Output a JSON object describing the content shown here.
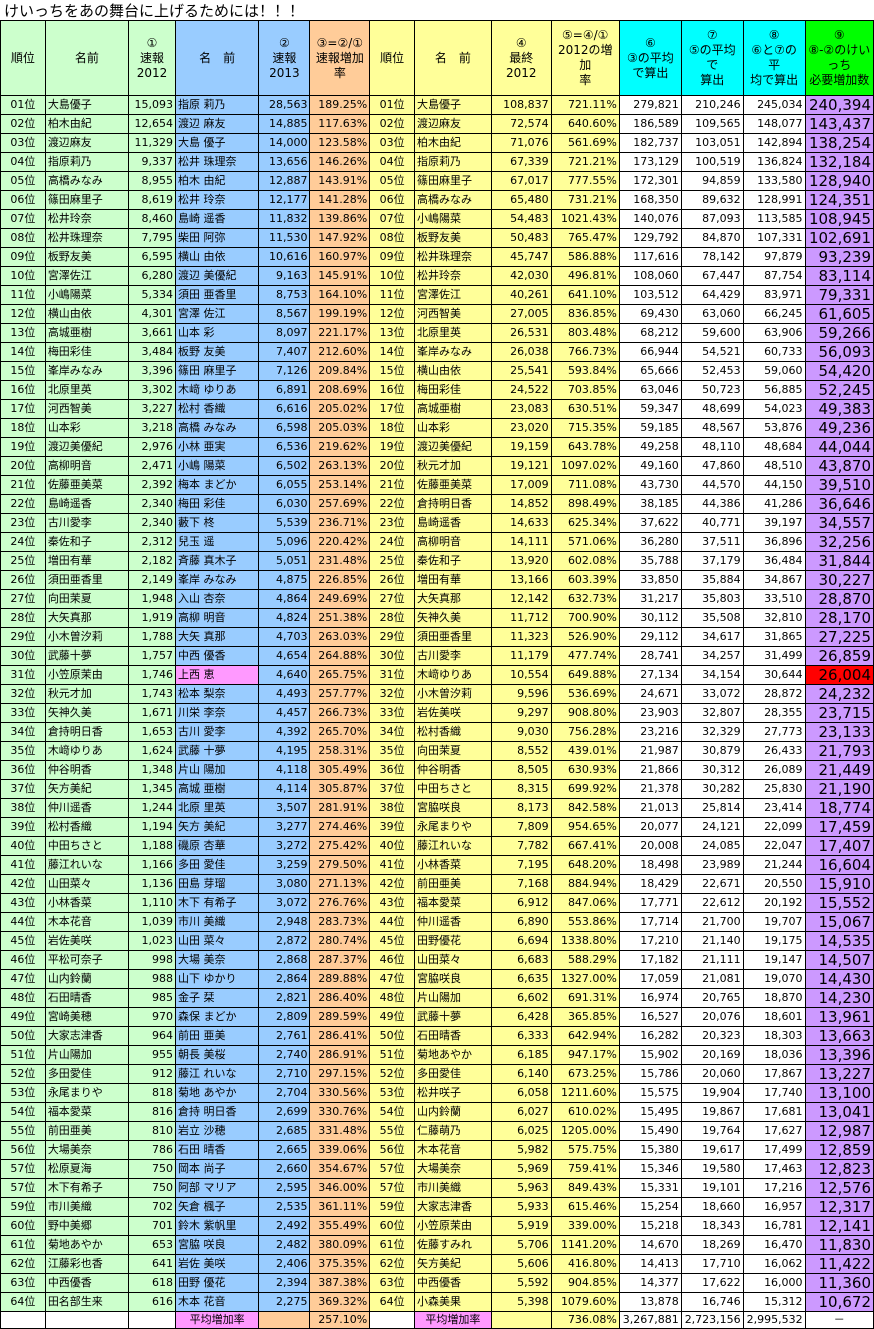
{
  "title": "けいっちをあの舞台に上げるためには！！！",
  "headers": [
    "順位",
    "名前",
    "①\n速報\n2012",
    "名　前",
    "②\n速報\n2013",
    "③=②/①\n速報増加\n率",
    "順位",
    "名　前",
    "④\n最終\n2012",
    "⑤=④/①\n2012の増加\n率",
    "⑥\n③の平均\nで算出",
    "⑦\n⑤の平均で\n算出",
    "⑧\n⑥と⑦の平\n均で算出",
    "⑨\n⑧-②のけいっち\n必要増加数"
  ],
  "rows": [
    [
      "01位",
      "大島優子",
      "15,093",
      "指原 莉乃",
      "28,563",
      "189.25%",
      "01位",
      "大島優子",
      "108,837",
      "721.11%",
      "279,821",
      "210,246",
      "245,034",
      "240,394"
    ],
    [
      "02位",
      "柏木由紀",
      "12,654",
      "渡辺 麻友",
      "14,885",
      "117.63%",
      "02位",
      "渡辺麻友",
      "72,574",
      "640.60%",
      "186,589",
      "109,565",
      "148,077",
      "143,437"
    ],
    [
      "03位",
      "渡辺麻友",
      "11,329",
      "大島 優子",
      "14,000",
      "123.58%",
      "03位",
      "柏木由紀",
      "71,076",
      "561.69%",
      "182,737",
      "103,051",
      "142,894",
      "138,254"
    ],
    [
      "04位",
      "指原莉乃",
      "9,337",
      "松井 珠理奈",
      "13,656",
      "146.26%",
      "04位",
      "指原莉乃",
      "67,339",
      "721.21%",
      "173,129",
      "100,519",
      "136,824",
      "132,184"
    ],
    [
      "05位",
      "高橋みなみ",
      "8,955",
      "柏木 由紀",
      "12,887",
      "143.91%",
      "05位",
      "篠田麻里子",
      "67,017",
      "777.55%",
      "172,301",
      "94,859",
      "133,580",
      "128,940"
    ],
    [
      "06位",
      "篠田麻里子",
      "8,619",
      "松井 玲奈",
      "12,177",
      "141.28%",
      "06位",
      "高橋みなみ",
      "65,480",
      "731.21%",
      "168,350",
      "89,632",
      "128,991",
      "124,351"
    ],
    [
      "07位",
      "松井玲奈",
      "8,460",
      "島崎 遥香",
      "11,832",
      "139.86%",
      "07位",
      "小嶋陽菜",
      "54,483",
      "1021.43%",
      "140,076",
      "87,093",
      "113,585",
      "108,945"
    ],
    [
      "08位",
      "松井珠理奈",
      "7,795",
      "柴田 阿弥",
      "11,530",
      "147.92%",
      "08位",
      "板野友美",
      "50,483",
      "765.47%",
      "129,792",
      "84,870",
      "107,331",
      "102,691"
    ],
    [
      "09位",
      "板野友美",
      "6,595",
      "横山 由依",
      "10,616",
      "160.97%",
      "09位",
      "松井珠理奈",
      "45,747",
      "586.88%",
      "117,616",
      "78,142",
      "97,879",
      "93,239"
    ],
    [
      "10位",
      "宮澤佐江",
      "6,280",
      "渡辺 美優紀",
      "9,163",
      "145.91%",
      "10位",
      "松井玲奈",
      "42,030",
      "496.81%",
      "108,060",
      "67,447",
      "87,754",
      "83,114"
    ],
    [
      "11位",
      "小嶋陽菜",
      "5,334",
      "須田 亜香里",
      "8,753",
      "164.10%",
      "11位",
      "宮澤佐江",
      "40,261",
      "641.10%",
      "103,512",
      "64,429",
      "83,971",
      "79,331"
    ],
    [
      "12位",
      "横山由依",
      "4,301",
      "宮澤 佐江",
      "8,567",
      "199.19%",
      "12位",
      "河西智美",
      "27,005",
      "836.85%",
      "69,430",
      "63,060",
      "66,245",
      "61,605"
    ],
    [
      "13位",
      "高城亜樹",
      "3,661",
      "山本 彩",
      "8,097",
      "221.17%",
      "13位",
      "北原里英",
      "26,531",
      "803.48%",
      "68,212",
      "59,600",
      "63,906",
      "59,266"
    ],
    [
      "14位",
      "梅田彩佳",
      "3,484",
      "板野 友美",
      "7,407",
      "212.60%",
      "14位",
      "峯岸みなみ",
      "26,038",
      "766.73%",
      "66,944",
      "54,521",
      "60,733",
      "56,093"
    ],
    [
      "15位",
      "峯岸みなみ",
      "3,396",
      "篠田 麻里子",
      "7,126",
      "209.84%",
      "15位",
      "横山由依",
      "25,541",
      "593.84%",
      "65,666",
      "52,453",
      "59,060",
      "54,420"
    ],
    [
      "16位",
      "北原里英",
      "3,302",
      "木﨑 ゆりあ",
      "6,891",
      "208.69%",
      "16位",
      "梅田彩佳",
      "24,522",
      "703.85%",
      "63,046",
      "50,723",
      "56,885",
      "52,245"
    ],
    [
      "17位",
      "河西智美",
      "3,227",
      "松村 香織",
      "6,616",
      "205.02%",
      "17位",
      "高城亜樹",
      "23,083",
      "630.51%",
      "59,347",
      "48,699",
      "54,023",
      "49,383"
    ],
    [
      "18位",
      "山本彩",
      "3,218",
      "高橋 みなみ",
      "6,598",
      "205.03%",
      "18位",
      "山本彩",
      "23,020",
      "715.35%",
      "59,185",
      "48,567",
      "53,876",
      "49,236"
    ],
    [
      "19位",
      "渡辺美優紀",
      "2,976",
      "小林 亜実",
      "6,536",
      "219.62%",
      "19位",
      "渡辺美優紀",
      "19,159",
      "643.78%",
      "49,258",
      "48,110",
      "48,684",
      "44,044"
    ],
    [
      "20位",
      "高柳明音",
      "2,471",
      "小嶋 陽菜",
      "6,502",
      "263.13%",
      "20位",
      "秋元才加",
      "19,121",
      "1097.02%",
      "49,160",
      "47,860",
      "48,510",
      "43,870"
    ],
    [
      "21位",
      "佐藤亜美菜",
      "2,392",
      "梅本 まどか",
      "6,055",
      "253.14%",
      "21位",
      "佐藤亜美菜",
      "17,009",
      "711.08%",
      "43,730",
      "44,570",
      "44,150",
      "39,510"
    ],
    [
      "22位",
      "島崎遥香",
      "2,340",
      "梅田 彩佳",
      "6,030",
      "257.69%",
      "22位",
      "倉持明日香",
      "14,852",
      "898.49%",
      "38,185",
      "44,386",
      "41,286",
      "36,646"
    ],
    [
      "23位",
      "古川愛李",
      "2,340",
      "藪下 柊",
      "5,539",
      "236.71%",
      "23位",
      "島崎遥香",
      "14,633",
      "625.34%",
      "37,622",
      "40,771",
      "39,197",
      "34,557"
    ],
    [
      "24位",
      "秦佐和子",
      "2,312",
      "兒玉 遥",
      "5,096",
      "220.42%",
      "24位",
      "高柳明音",
      "14,111",
      "571.06%",
      "36,280",
      "37,511",
      "36,896",
      "32,256"
    ],
    [
      "25位",
      "増田有華",
      "2,182",
      "斉藤 真木子",
      "5,051",
      "231.48%",
      "25位",
      "秦佐和子",
      "13,920",
      "602.08%",
      "35,788",
      "37,179",
      "36,484",
      "31,844"
    ],
    [
      "26位",
      "須田亜香里",
      "2,149",
      "峯岸 みなみ",
      "4,875",
      "226.85%",
      "26位",
      "増田有華",
      "13,166",
      "603.39%",
      "33,850",
      "35,884",
      "34,867",
      "30,227"
    ],
    [
      "27位",
      "向田茉夏",
      "1,948",
      "入山 杏奈",
      "4,864",
      "249.69%",
      "27位",
      "大矢真那",
      "12,142",
      "632.73%",
      "31,217",
      "35,803",
      "33,510",
      "28,870"
    ],
    [
      "28位",
      "大矢真那",
      "1,919",
      "高柳 明音",
      "4,824",
      "251.38%",
      "28位",
      "矢神久美",
      "11,712",
      "700.90%",
      "30,112",
      "35,508",
      "32,810",
      "28,170"
    ],
    [
      "29位",
      "小木曽汐莉",
      "1,788",
      "大矢 真那",
      "4,703",
      "263.03%",
      "29位",
      "須田亜香里",
      "11,323",
      "526.90%",
      "29,112",
      "34,617",
      "31,865",
      "27,225"
    ],
    [
      "30位",
      "武藤十夢",
      "1,757",
      "中西 優香",
      "4,654",
      "264.88%",
      "30位",
      "古川愛李",
      "11,179",
      "477.74%",
      "28,741",
      "34,257",
      "31,499",
      "26,859"
    ],
    [
      "31位",
      "小笠原茉由",
      "1,746",
      "上西 恵",
      "4,640",
      "265.75%",
      "31位",
      "木﨑ゆりあ",
      "10,554",
      "649.88%",
      "27,134",
      "34,154",
      "30,644",
      "26,004"
    ],
    [
      "32位",
      "秋元才加",
      "1,743",
      "松本 梨奈",
      "4,493",
      "257.77%",
      "32位",
      "小木曽汐莉",
      "9,596",
      "536.69%",
      "24,671",
      "33,072",
      "28,872",
      "24,232"
    ],
    [
      "33位",
      "矢神久美",
      "1,671",
      "川栄 李奈",
      "4,457",
      "266.73%",
      "33位",
      "岩佐美咲",
      "9,297",
      "908.80%",
      "23,903",
      "32,807",
      "28,355",
      "23,715"
    ],
    [
      "34位",
      "倉持明日香",
      "1,653",
      "古川 愛李",
      "4,392",
      "265.70%",
      "34位",
      "松村香織",
      "9,030",
      "756.28%",
      "23,216",
      "32,329",
      "27,773",
      "23,133"
    ],
    [
      "35位",
      "木﨑ゆりあ",
      "1,624",
      "武藤 十夢",
      "4,195",
      "258.31%",
      "35位",
      "向田茉夏",
      "8,552",
      "439.01%",
      "21,987",
      "30,879",
      "26,433",
      "21,793"
    ],
    [
      "36位",
      "仲谷明香",
      "1,348",
      "片山 陽加",
      "4,118",
      "305.49%",
      "36位",
      "仲谷明香",
      "8,505",
      "630.93%",
      "21,866",
      "30,312",
      "26,089",
      "21,449"
    ],
    [
      "37位",
      "矢方美紀",
      "1,345",
      "高城 亜樹",
      "4,114",
      "305.87%",
      "37位",
      "中田ちさと",
      "8,315",
      "699.92%",
      "21,378",
      "30,282",
      "25,830",
      "21,190"
    ],
    [
      "38位",
      "仲川遥香",
      "1,244",
      "北原 里英",
      "3,507",
      "281.91%",
      "38位",
      "宮脇咲良",
      "8,173",
      "842.58%",
      "21,013",
      "25,814",
      "23,414",
      "18,774"
    ],
    [
      "39位",
      "松村香織",
      "1,194",
      "矢方 美紀",
      "3,277",
      "274.46%",
      "39位",
      "永尾まりや",
      "7,809",
      "954.65%",
      "20,077",
      "24,121",
      "22,099",
      "17,459"
    ],
    [
      "40位",
      "中田ちさと",
      "1,188",
      "磯原 杏華",
      "3,272",
      "275.42%",
      "40位",
      "藤江れいな",
      "7,782",
      "667.41%",
      "20,008",
      "24,085",
      "22,047",
      "17,407"
    ],
    [
      "41位",
      "藤江れいな",
      "1,166",
      "多田 愛佳",
      "3,259",
      "279.50%",
      "41位",
      "小林香菜",
      "7,195",
      "648.20%",
      "18,498",
      "23,989",
      "21,244",
      "16,604"
    ],
    [
      "42位",
      "山田菜々",
      "1,136",
      "田島 芽瑠",
      "3,080",
      "271.13%",
      "42位",
      "前田亜美",
      "7,168",
      "884.94%",
      "18,429",
      "22,671",
      "20,550",
      "15,910"
    ],
    [
      "43位",
      "小林香菜",
      "1,110",
      "木下 有希子",
      "3,072",
      "276.76%",
      "43位",
      "福本愛菜",
      "6,912",
      "847.06%",
      "17,771",
      "22,612",
      "20,192",
      "15,552"
    ],
    [
      "44位",
      "木本花音",
      "1,039",
      "市川 美織",
      "2,948",
      "283.73%",
      "44位",
      "仲川遥香",
      "6,890",
      "553.86%",
      "17,714",
      "21,700",
      "19,707",
      "15,067"
    ],
    [
      "45位",
      "岩佐美咲",
      "1,023",
      "山田 菜々",
      "2,872",
      "280.74%",
      "45位",
      "田野優花",
      "6,694",
      "1338.80%",
      "17,210",
      "21,140",
      "19,175",
      "14,535"
    ],
    [
      "46位",
      "平松可奈子",
      "998",
      "大場 美奈",
      "2,868",
      "287.37%",
      "46位",
      "山田菜々",
      "6,683",
      "588.29%",
      "17,182",
      "21,111",
      "19,147",
      "14,507"
    ],
    [
      "47位",
      "山内鈴蘭",
      "988",
      "山下 ゆかり",
      "2,864",
      "289.88%",
      "47位",
      "宮脇咲良",
      "6,635",
      "1327.00%",
      "17,059",
      "21,081",
      "19,070",
      "14,430"
    ],
    [
      "48位",
      "石田晴香",
      "985",
      "金子 栞",
      "2,821",
      "286.40%",
      "48位",
      "片山陽加",
      "6,602",
      "691.31%",
      "16,974",
      "20,765",
      "18,870",
      "14,230"
    ],
    [
      "49位",
      "宮崎美穂",
      "970",
      "森保 まどか",
      "2,809",
      "289.59%",
      "49位",
      "武藤十夢",
      "6,428",
      "365.85%",
      "16,527",
      "20,076",
      "18,601",
      "13,961"
    ],
    [
      "50位",
      "大家志津香",
      "964",
      "前田 亜美",
      "2,761",
      "286.41%",
      "50位",
      "石田晴香",
      "6,333",
      "642.94%",
      "16,282",
      "20,323",
      "18,303",
      "13,663"
    ],
    [
      "51位",
      "片山陽加",
      "955",
      "朝長 美桜",
      "2,740",
      "286.91%",
      "51位",
      "菊地あやか",
      "6,185",
      "947.17%",
      "15,902",
      "20,169",
      "18,036",
      "13,396"
    ],
    [
      "52位",
      "多田愛佳",
      "912",
      "藤江 れいな",
      "2,710",
      "297.15%",
      "52位",
      "多田愛佳",
      "6,140",
      "673.25%",
      "15,786",
      "20,060",
      "17,867",
      "13,227"
    ],
    [
      "53位",
      "永尾まりや",
      "818",
      "菊地 あやか",
      "2,704",
      "330.56%",
      "53位",
      "松井咲子",
      "6,058",
      "1211.60%",
      "15,575",
      "19,904",
      "17,740",
      "13,100"
    ],
    [
      "54位",
      "福本愛菜",
      "816",
      "倉持 明日香",
      "2,699",
      "330.76%",
      "54位",
      "山内鈴蘭",
      "6,027",
      "610.02%",
      "15,495",
      "19,867",
      "17,681",
      "13,041"
    ],
    [
      "55位",
      "前田亜美",
      "810",
      "岩立 沙穂",
      "2,685",
      "331.48%",
      "55位",
      "仁藤萌乃",
      "6,025",
      "1205.00%",
      "15,490",
      "19,764",
      "17,627",
      "12,987"
    ],
    [
      "56位",
      "大場美奈",
      "786",
      "石田 晴香",
      "2,665",
      "339.06%",
      "56位",
      "木本花音",
      "5,982",
      "575.75%",
      "15,380",
      "19,617",
      "17,499",
      "12,859"
    ],
    [
      "57位",
      "松原夏海",
      "750",
      "岡本 尚子",
      "2,660",
      "354.67%",
      "57位",
      "大場美奈",
      "5,969",
      "759.41%",
      "15,346",
      "19,580",
      "17,463",
      "12,823"
    ],
    [
      "57位",
      "木下有希子",
      "750",
      "阿部 マリア",
      "2,595",
      "346.00%",
      "57位",
      "市川美織",
      "5,963",
      "849.43%",
      "15,331",
      "19,101",
      "17,216",
      "12,576"
    ],
    [
      "59位",
      "市川美織",
      "702",
      "矢倉 楓子",
      "2,535",
      "361.11%",
      "59位",
      "大家志津香",
      "5,933",
      "615.46%",
      "15,254",
      "18,660",
      "16,957",
      "12,317"
    ],
    [
      "60位",
      "野中美郷",
      "701",
      "鈴木 紫帆里",
      "2,492",
      "355.49%",
      "60位",
      "小笠原茉由",
      "5,919",
      "339.00%",
      "15,218",
      "18,343",
      "16,781",
      "12,141"
    ],
    [
      "61位",
      "菊地あやか",
      "653",
      "宮脇 咲良",
      "2,482",
      "380.09%",
      "61位",
      "佐藤すみれ",
      "5,706",
      "1141.20%",
      "14,670",
      "18,269",
      "16,470",
      "11,830"
    ],
    [
      "62位",
      "江藤彩也香",
      "641",
      "岩佐 美咲",
      "2,406",
      "375.35%",
      "62位",
      "矢方美紀",
      "5,606",
      "416.80%",
      "14,413",
      "17,710",
      "16,062",
      "11,422"
    ],
    [
      "63位",
      "中西優香",
      "618",
      "田野 優花",
      "2,394",
      "387.38%",
      "63位",
      "中西優香",
      "5,592",
      "904.85%",
      "14,377",
      "17,622",
      "16,000",
      "11,360"
    ],
    [
      "64位",
      "田名部生来",
      "616",
      "木本 花音",
      "2,275",
      "369.32%",
      "64位",
      "小森美果",
      "5,398",
      "1079.60%",
      "13,878",
      "16,746",
      "15,312",
      "10,672"
    ]
  ],
  "footer": {
    "label_left": "平均増加率",
    "avg_left": "257.10%",
    "label_right": "平均増加率",
    "avg_right": "736.08%",
    "sum6": "3,267,881",
    "sum7": "2,723,156",
    "sum8": "2,995,532",
    "dash": "－"
  },
  "highlight": {
    "row_pink": 31,
    "col_pink": "名前2013",
    "red_cell": "26,004"
  }
}
